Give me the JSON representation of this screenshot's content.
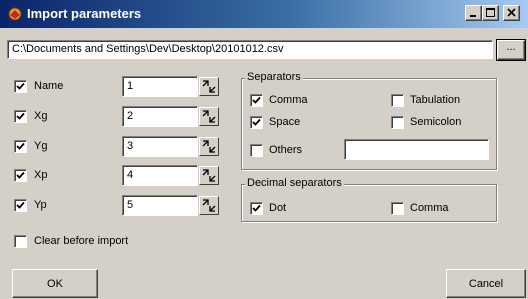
{
  "window": {
    "title": "Import parameters",
    "icon": "app-icon",
    "controls": {
      "minimize": "minimize-icon",
      "maximize": "maximize-icon",
      "close": "close-icon"
    }
  },
  "file": {
    "path": "C:\\Documents and Settings\\Dev\\Desktop\\20101012.csv",
    "browse_label": "..."
  },
  "fields": [
    {
      "label": "Name",
      "checked": true,
      "value": "1"
    },
    {
      "label": "Xg",
      "checked": true,
      "value": "2"
    },
    {
      "label": "Yg",
      "checked": true,
      "value": "3"
    },
    {
      "label": "Xp",
      "checked": true,
      "value": "4"
    },
    {
      "label": "Yp",
      "checked": true,
      "value": "5"
    }
  ],
  "separators": {
    "title": "Separators",
    "comma": {
      "label": "Comma",
      "checked": true
    },
    "tabulation": {
      "label": "Tabulation",
      "checked": false
    },
    "space": {
      "label": "Space",
      "checked": true
    },
    "semicolon": {
      "label": "Semicolon",
      "checked": false
    },
    "others": {
      "label": "Others",
      "checked": false,
      "value": ""
    }
  },
  "decimal": {
    "title": "Decimal separators",
    "dot": {
      "label": "Dot",
      "checked": true
    },
    "comma": {
      "label": "Comma",
      "checked": false
    }
  },
  "clear_before_import": {
    "label": "Clear before import",
    "checked": false
  },
  "buttons": {
    "ok": "OK",
    "cancel": "Cancel"
  }
}
